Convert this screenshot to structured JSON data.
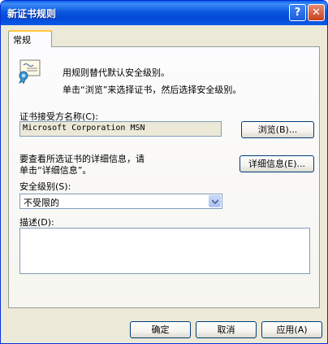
{
  "window": {
    "title": "新证书规则",
    "help_glyph": "?",
    "close_glyph": "✕"
  },
  "tabs": [
    {
      "label": "常规"
    }
  ],
  "intro": {
    "line1": "用规则替代默认安全级别。",
    "line2": "单击“浏览”来选择证书，然后选择安全级别。"
  },
  "subject": {
    "label": "证书接受方名称(C):",
    "value": "Microsoft Corporation MSN",
    "browse_label": "浏览(B)..."
  },
  "details": {
    "line1": "要查看所选证书的详细信息，请",
    "line2": "单击“详细信息”。",
    "button_label": "详细信息(E)..."
  },
  "security": {
    "label": "安全级别(S):",
    "selected": "不受限的"
  },
  "description": {
    "label": "描述(D):",
    "value": ""
  },
  "footer": {
    "ok": "确定",
    "cancel": "取消",
    "apply": "应用(A)"
  }
}
